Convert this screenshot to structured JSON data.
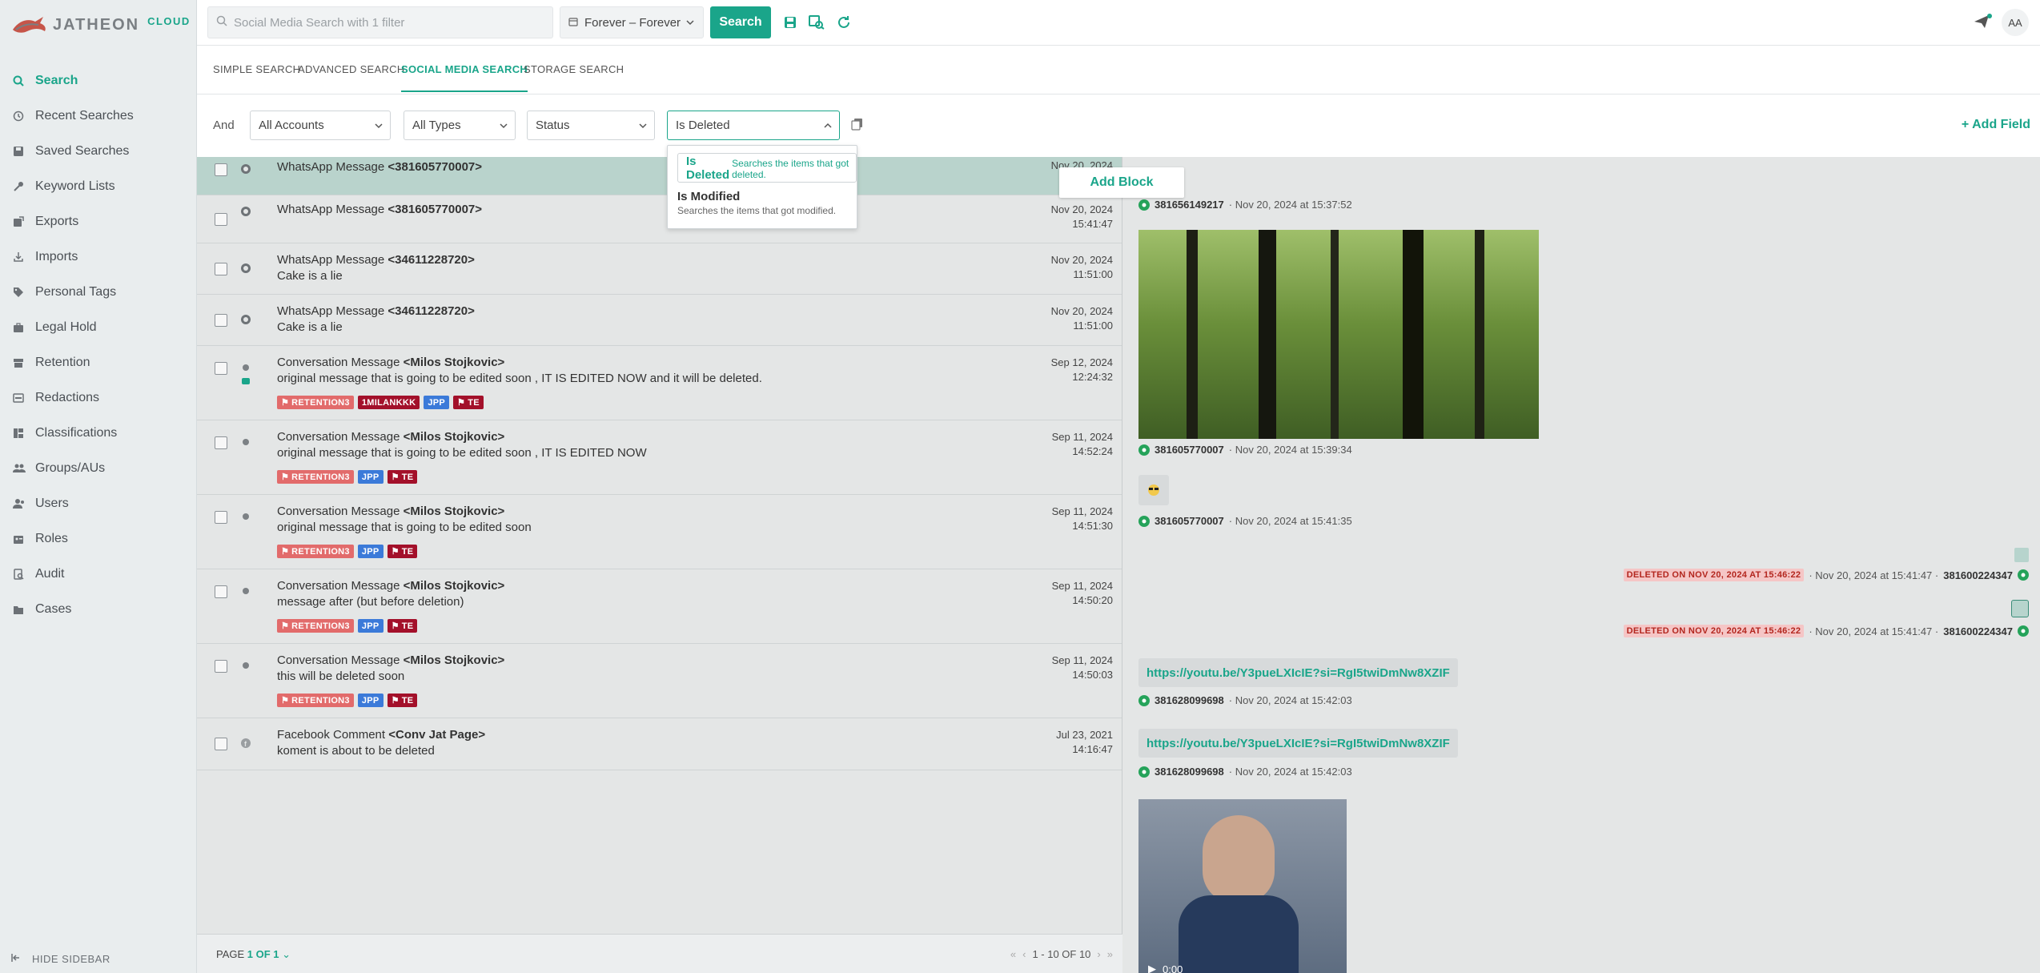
{
  "brand": {
    "name": "JATHEON",
    "suffix": "CLOUD"
  },
  "sidebar": {
    "items": [
      {
        "label": "Search",
        "icon": "search-icon",
        "active": true
      },
      {
        "label": "Recent Searches",
        "icon": "history-icon"
      },
      {
        "label": "Saved Searches",
        "icon": "save-icon"
      },
      {
        "label": "Keyword Lists",
        "icon": "key-icon"
      },
      {
        "label": "Exports",
        "icon": "export-icon"
      },
      {
        "label": "Imports",
        "icon": "import-icon"
      },
      {
        "label": "Personal Tags",
        "icon": "tag-icon"
      },
      {
        "label": "Legal Hold",
        "icon": "briefcase-icon"
      },
      {
        "label": "Retention",
        "icon": "retention-icon"
      },
      {
        "label": "Redactions",
        "icon": "redact-icon"
      },
      {
        "label": "Classifications",
        "icon": "classification-icon"
      },
      {
        "label": "Groups/AUs",
        "icon": "groups-icon"
      },
      {
        "label": "Users",
        "icon": "users-icon"
      },
      {
        "label": "Roles",
        "icon": "roles-icon"
      },
      {
        "label": "Audit",
        "icon": "audit-icon"
      },
      {
        "label": "Cases",
        "icon": "folder-icon"
      }
    ],
    "hide_label": "HIDE SIDEBAR"
  },
  "topbar": {
    "search_placeholder": "Social Media Search with 1 filter",
    "date_range": "Forever – Forever",
    "search_button": "Search",
    "avatar": "AA",
    "accent": "#1aa58a"
  },
  "tabs": [
    {
      "label": "SIMPLE SEARCH"
    },
    {
      "label": "ADVANCED SEARCH"
    },
    {
      "label": "SOCIAL MEDIA SEARCH",
      "active": true
    },
    {
      "label": "STORAGE SEARCH"
    }
  ],
  "filters": {
    "operator": "And",
    "accounts": "All Accounts",
    "types": "All Types",
    "status": "Status",
    "deleted": "Is Deleted",
    "add_field": "+ Add Field"
  },
  "dropdown": {
    "options": [
      {
        "label": "Is Deleted",
        "desc": "Searches the items that got deleted."
      },
      {
        "label": "Is Modified",
        "desc": "Searches the items that got modified."
      }
    ]
  },
  "rows": [
    {
      "kind": "WhatsApp Message",
      "from": "<381605770007>",
      "body": "",
      "date": "Nov 20, 2024",
      "time": "",
      "icon": "whatsapp-icon"
    },
    {
      "kind": "WhatsApp Message",
      "from": "<381605770007>",
      "body": "",
      "date": "Nov 20, 2024",
      "time": "15:41:47",
      "icon": "whatsapp-icon"
    },
    {
      "kind": "WhatsApp Message",
      "from": "<34611228720>",
      "body": "Cake is a lie",
      "date": "Nov 20, 2024",
      "time": "11:51:00",
      "icon": "whatsapp-icon"
    },
    {
      "kind": "WhatsApp Message",
      "from": "<34611228720>",
      "body": "Cake is a lie",
      "date": "Nov 20, 2024",
      "time": "11:51:00",
      "icon": "whatsapp-icon"
    },
    {
      "kind": "Conversation Message",
      "from": "<Milos Stojkovic>",
      "body": "original message that is going to be edited soon , IT IS EDITED NOW and it will be deleted.",
      "date": "Sep 12, 2024",
      "time": "12:24:32",
      "icon": "teams-icon",
      "tags": [
        "RETENTION3",
        "1MILANKKK",
        "JPP",
        "TE"
      ]
    },
    {
      "kind": "Conversation Message",
      "from": "<Milos Stojkovic>",
      "body": "original message that is going to be edited soon , IT IS EDITED NOW",
      "date": "Sep 11, 2024",
      "time": "14:52:24",
      "icon": "teams-icon",
      "tags": [
        "RETENTION3",
        "JPP",
        "TE"
      ]
    },
    {
      "kind": "Conversation Message",
      "from": "<Milos Stojkovic>",
      "body": "original message that is going to be edited soon",
      "date": "Sep 11, 2024",
      "time": "14:51:30",
      "icon": "teams-icon",
      "tags": [
        "RETENTION3",
        "JPP",
        "TE"
      ]
    },
    {
      "kind": "Conversation Message",
      "from": "<Milos Stojkovic>",
      "body": "message after (but before deletion)",
      "date": "Sep 11, 2024",
      "time": "14:50:20",
      "icon": "teams-icon",
      "tags": [
        "RETENTION3",
        "JPP",
        "TE"
      ]
    },
    {
      "kind": "Conversation Message",
      "from": "<Milos Stojkovic>",
      "body": "this will be deleted soon",
      "date": "Sep 11, 2024",
      "time": "14:50:03",
      "icon": "teams-icon",
      "tags": [
        "RETENTION3",
        "JPP",
        "TE"
      ]
    },
    {
      "kind": "Facebook Comment",
      "from": "<Conv Jat Page>",
      "body": "koment is about to be deleted",
      "date": "Jul 23, 2021",
      "time": "14:16:47",
      "icon": "facebook-icon"
    }
  ],
  "pager": {
    "label": "PAGE",
    "value": "1 OF 1",
    "range": "1 - 10 OF 10"
  },
  "preview": {
    "add_block": "Add Block",
    "msg1": {
      "num": "381656149217",
      "ts": "· Nov 20, 2024 at 15:37:52"
    },
    "msg2": {
      "num": "381605770007",
      "ts": "· Nov 20, 2024 at 15:39:34"
    },
    "msg3": {
      "num": "381605770007",
      "ts": "· Nov 20, 2024 at 15:41:35"
    },
    "del1": {
      "badge": "DELETED ON NOV 20, 2024 AT 15:46:22",
      "ts": "· Nov 20, 2024 at 15:41:47 ·",
      "num": "381600224347"
    },
    "del2": {
      "badge": "DELETED ON NOV 20, 2024 AT 15:46:22",
      "ts": "· Nov 20, 2024 at 15:41:47 ·",
      "num": "381600224347"
    },
    "link1": "https://youtu.be/Y3pueLXIcIE?si=RgI5twiDmNw8XZIF",
    "msg4": {
      "num": "381628099698",
      "ts": "· Nov 20, 2024 at 15:42:03"
    },
    "link2": "https://youtu.be/Y3pueLXIcIE?si=RgI5twiDmNw8XZIF",
    "msg5": {
      "num": "381628099698",
      "ts": "· Nov 20, 2024 at 15:42:03"
    },
    "video_time": "0:00"
  }
}
